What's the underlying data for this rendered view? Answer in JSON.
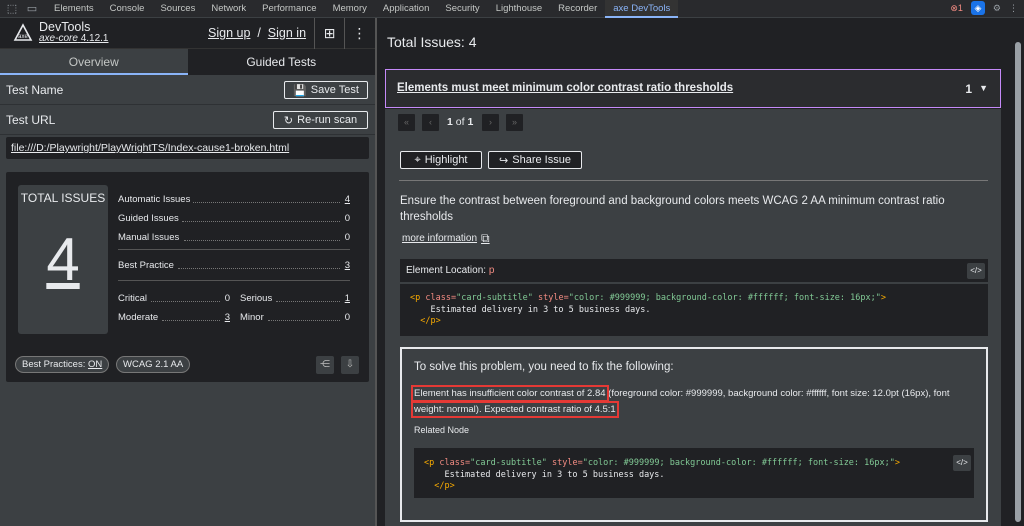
{
  "devtools_tabs": [
    "Elements",
    "Console",
    "Sources",
    "Network",
    "Performance",
    "Memory",
    "Application",
    "Security",
    "Lighthouse",
    "Recorder",
    "axe DevTools"
  ],
  "error_count": "1",
  "app": {
    "title": "DevTools",
    "product": "axe-core",
    "version": "4.12.1",
    "sign_up": "Sign up",
    "separator": "/",
    "sign_in": "Sign in"
  },
  "tabs": {
    "overview": "Overview",
    "guided": "Guided Tests"
  },
  "test_name": {
    "label": "Test Name",
    "button": "Save Test"
  },
  "test_url": {
    "label": "Test URL",
    "button": "Re-run scan",
    "value": "file:///D:/Playwright/PlayWrightTS/Index-cause1-broken.html"
  },
  "summary": {
    "total_label": "TOTAL ISSUES",
    "total": "4",
    "automatic_label": "Automatic Issues",
    "automatic": "4",
    "guided_label": "Guided Issues",
    "guided": "0",
    "manual_label": "Manual Issues",
    "manual": "0",
    "best_label": "Best Practice",
    "best": "3",
    "critical_label": "Critical",
    "critical": "0",
    "serious_label": "Serious",
    "serious": "1",
    "moderate_label": "Moderate",
    "moderate": "3",
    "minor_label": "Minor",
    "minor": "0"
  },
  "footer": {
    "best_practices_label": "Best Practices:",
    "best_practices_value": "ON",
    "standard": "WCAG 2.1 AA"
  },
  "right": {
    "title": "Total Issues: 4",
    "issue_title": "Elements must meet minimum color contrast ratio thresholds",
    "issue_count": "1",
    "pager_current": "1",
    "pager_of": "of",
    "pager_total": "1",
    "highlight": "Highlight",
    "share": "Share Issue",
    "description": "Ensure the contrast between foreground and background colors meets WCAG 2 AA minimum contrast ratio thresholds",
    "more_info": "more information",
    "element_location_label": "Element Location:",
    "element_location_value": "p",
    "fix_title": "To solve this problem, you need to fix the following:",
    "fix_part1": "Element has insufficient color contrast of 2.84",
    "fix_part2": " (foreground color: #999999, background color: #ffffff, font size: 12.0pt (16px), font ",
    "fix_part3": "weight: normal). Expected contrast ratio of 4.5:1",
    "related_node": "Related Node"
  },
  "code": {
    "open_tag": "<p",
    "class_attr": "class=",
    "class_val": "\"card-subtitle\"",
    "style_attr": "style=",
    "style_val": "\"color: #999999; background-color: #ffffff; font-size: 16px;\"",
    "close_open": ">",
    "text": "Estimated delivery in 3 to 5 business days.",
    "end_tag": "</p>"
  },
  "colors": {
    "accent": "#8ab4f8",
    "highlight_border": "#c58af9",
    "error_box": "#e53935"
  }
}
